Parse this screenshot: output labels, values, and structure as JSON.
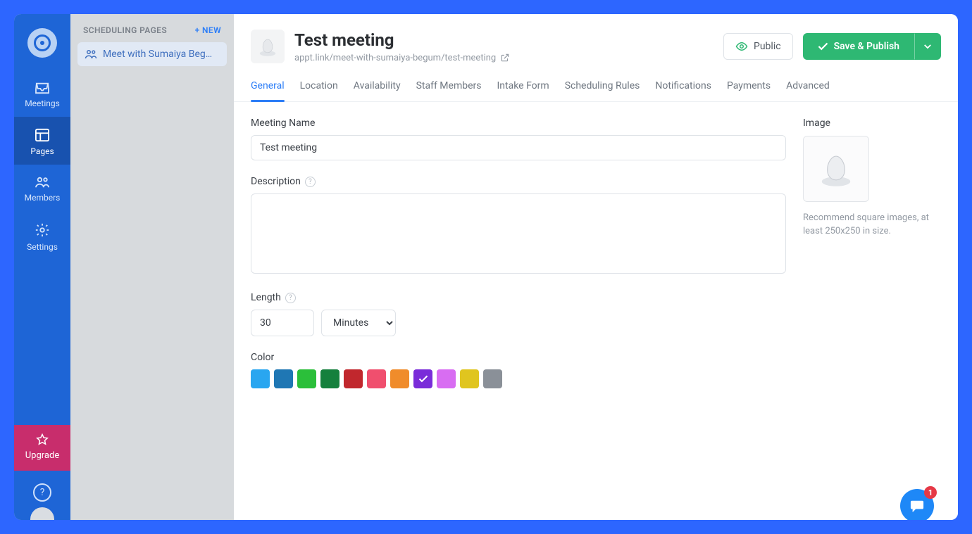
{
  "rail": {
    "items": [
      {
        "label": "Meetings"
      },
      {
        "label": "Pages"
      },
      {
        "label": "Members"
      },
      {
        "label": "Settings"
      }
    ],
    "upgrade_label": "Upgrade"
  },
  "scheduling": {
    "header_label": "SCHEDULING PAGES",
    "new_label": "+ NEW",
    "items": [
      {
        "label": "Meet with Sumaiya Beg…"
      }
    ]
  },
  "header": {
    "title": "Test meeting",
    "url": "appt.link/meet-with-sumaiya-begum/test-meeting",
    "public_label": "Public",
    "save_label": "Save & Publish"
  },
  "tabs": [
    {
      "label": "General",
      "active": true
    },
    {
      "label": "Location"
    },
    {
      "label": "Availability"
    },
    {
      "label": "Staff Members"
    },
    {
      "label": "Intake Form"
    },
    {
      "label": "Scheduling Rules"
    },
    {
      "label": "Notifications"
    },
    {
      "label": "Payments"
    },
    {
      "label": "Advanced"
    }
  ],
  "form": {
    "name_label": "Meeting Name",
    "name_value": "Test meeting",
    "description_label": "Description",
    "description_value": "",
    "length_label": "Length",
    "length_value": "30",
    "length_unit": "Minutes",
    "color_label": "Color",
    "colors": [
      {
        "hex": "#29a6f0",
        "name": "light-blue"
      },
      {
        "hex": "#1f77b4",
        "name": "blue"
      },
      {
        "hex": "#2bbf3a",
        "name": "green"
      },
      {
        "hex": "#15803d",
        "name": "dark-green"
      },
      {
        "hex": "#c1272d",
        "name": "red"
      },
      {
        "hex": "#f04f6e",
        "name": "pink"
      },
      {
        "hex": "#f08c2b",
        "name": "orange"
      },
      {
        "hex": "#7a2cd9",
        "name": "purple",
        "selected": true
      },
      {
        "hex": "#d86df2",
        "name": "magenta"
      },
      {
        "hex": "#e0c51f",
        "name": "yellow"
      },
      {
        "hex": "#8a9098",
        "name": "gray"
      }
    ]
  },
  "image_panel": {
    "label": "Image",
    "hint": "Recommend square images, at least 250x250 in size."
  },
  "chat": {
    "badge": "1"
  }
}
